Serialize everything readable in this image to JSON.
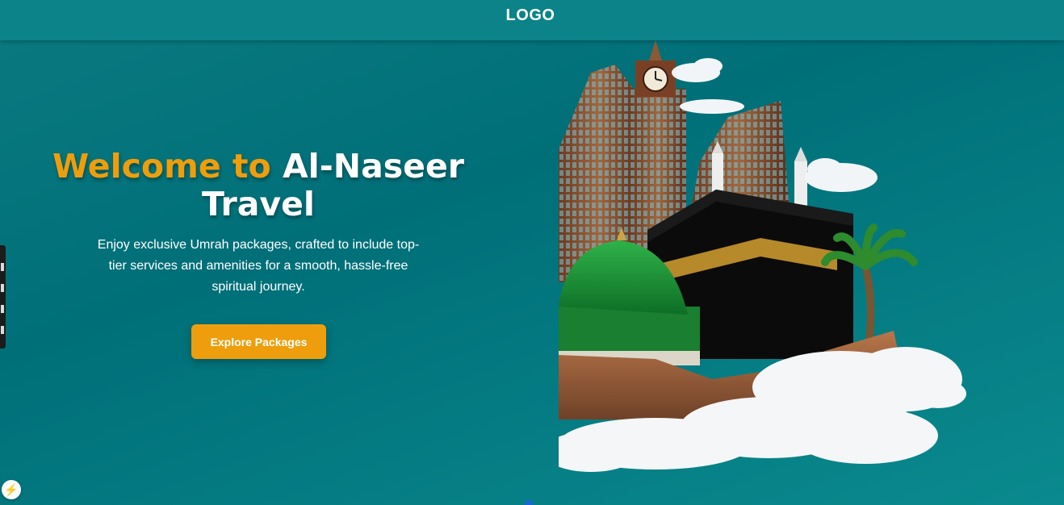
{
  "header": {
    "logo": "LOGO"
  },
  "hero": {
    "title_highlight": "Welcome to",
    "title_main": "Al-Naseer Travel",
    "description": "Enjoy exclusive Umrah packages, crafted to include top-tier services and amenities for a smooth, hassle-free spiritual journey.",
    "cta_label": "Explore Packages"
  },
  "colors": {
    "accent": "#ee9e0c",
    "background": "#007a80",
    "header": "#0b8388",
    "text": "#ffffff"
  },
  "icons": {
    "devtools": "bolt-icon",
    "hero_image": "mecca-medina-illustration"
  }
}
